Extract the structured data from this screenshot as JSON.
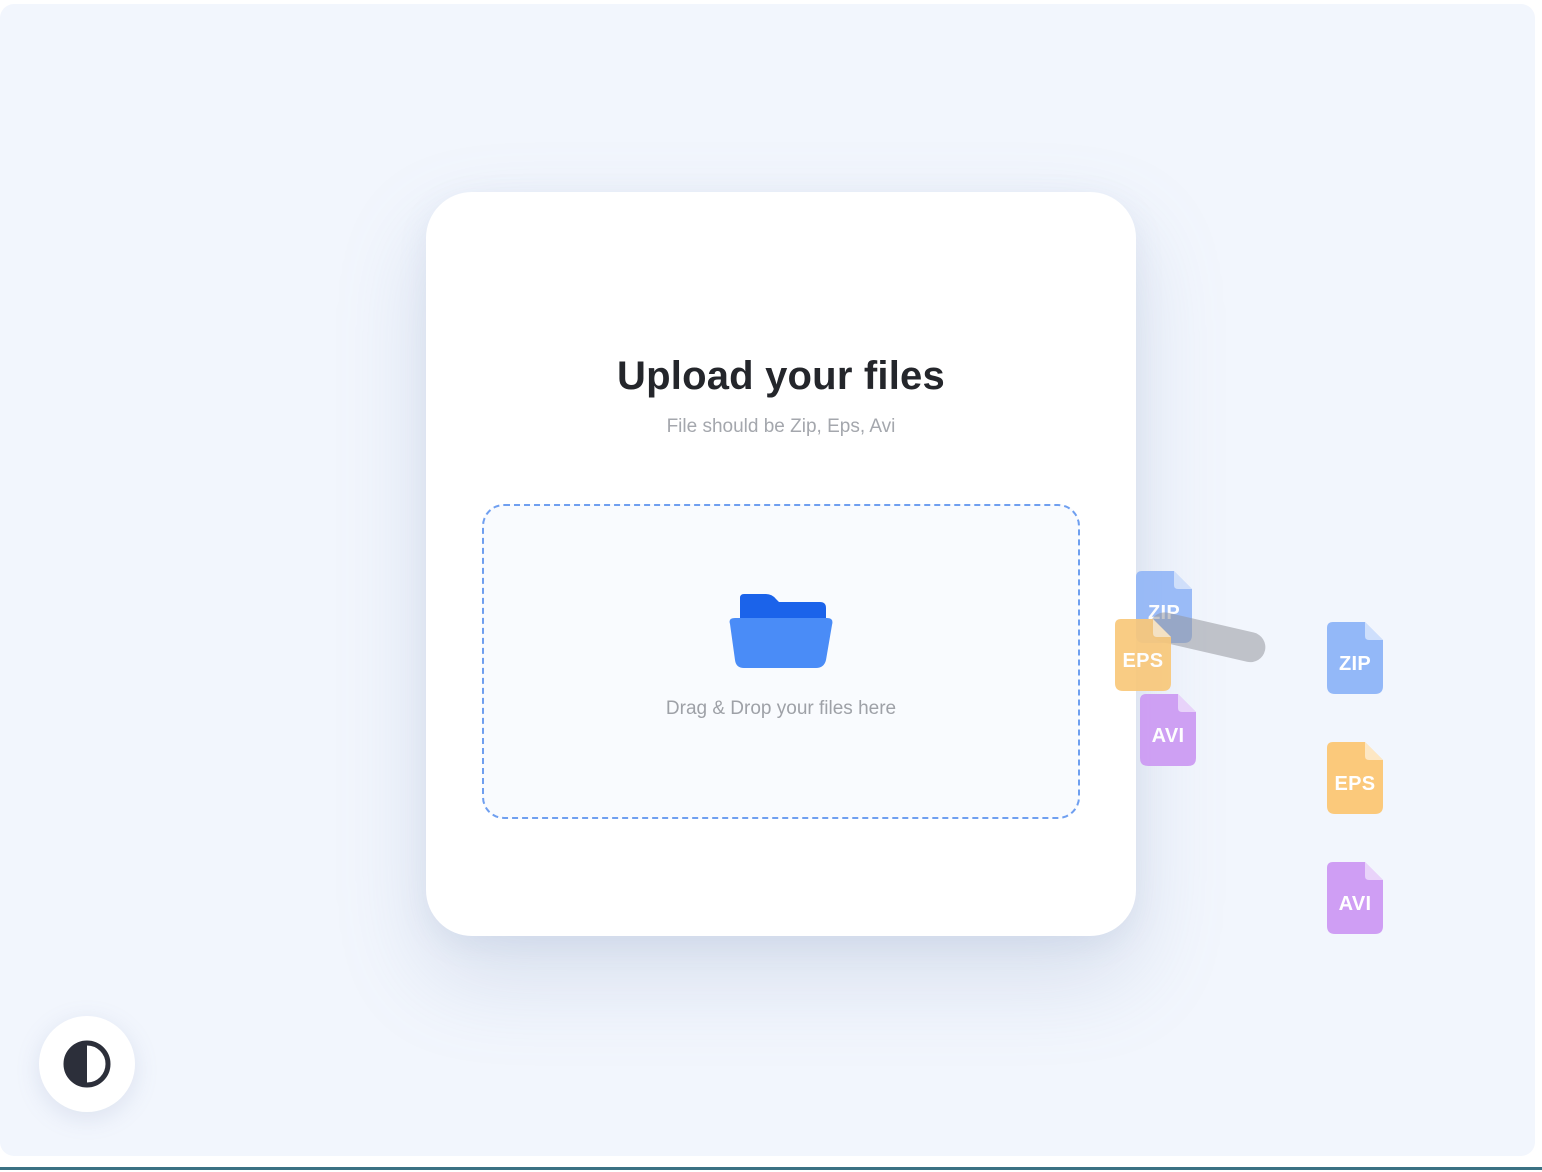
{
  "upload": {
    "title": "Upload your files",
    "subtitle": "File should be Zip, Eps, Avi",
    "drop_label": "Drag & Drop your files here"
  },
  "icons": {
    "folder": "folder-icon",
    "theme_toggle": "contrast-icon",
    "file": "file-icon"
  },
  "dragging_files": [
    {
      "ext": "ZIP",
      "color": "#8fb4f7"
    },
    {
      "ext": "EPS",
      "color": "#f9c87a"
    },
    {
      "ext": "AVI",
      "color": "#cd9cf3"
    }
  ],
  "file_stack": [
    {
      "ext": "ZIP",
      "color": "#93b8f8"
    },
    {
      "ext": "EPS",
      "color": "#fbc97b"
    },
    {
      "ext": "AVI",
      "color": "#cf9ef4"
    }
  ],
  "colors": {
    "accent": "#4a8cf7",
    "accent_dark": "#1c66ee",
    "background": "#f2f6fd",
    "dropzone_border": "#6f9ff0"
  }
}
